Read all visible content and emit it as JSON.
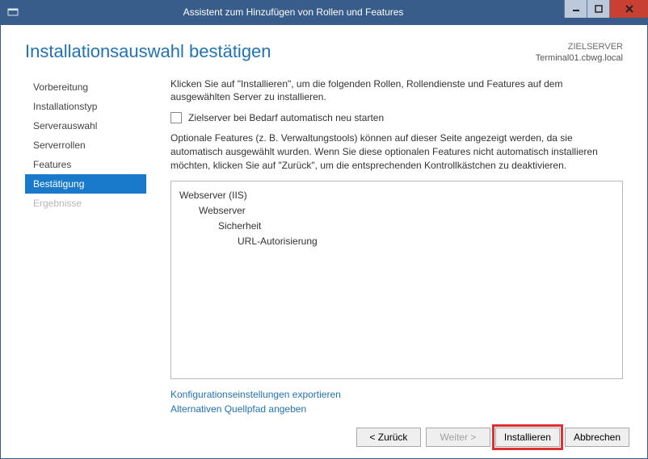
{
  "window": {
    "title": "Assistent zum Hinzufügen von Rollen und Features"
  },
  "header": {
    "heading": "Installationsauswahl bestätigen",
    "target_label": "ZIELSERVER",
    "target_value": "Terminal01.cbwg.local"
  },
  "nav": {
    "items": [
      {
        "label": "Vorbereitung"
      },
      {
        "label": "Installationstyp"
      },
      {
        "label": "Serverauswahl"
      },
      {
        "label": "Serverrollen"
      },
      {
        "label": "Features"
      },
      {
        "label": "Bestätigung"
      },
      {
        "label": "Ergebnisse"
      }
    ]
  },
  "content": {
    "description": "Klicken Sie auf \"Installieren\", um die folgenden Rollen, Rollendienste und Features auf dem ausgewählten Server zu installieren.",
    "restart_checkbox_label": "Zielserver bei Bedarf automatisch neu starten",
    "optional_text": "Optionale Features (z. B. Verwaltungstools) können auf dieser Seite angezeigt werden, da sie automatisch ausgewählt wurden. Wenn Sie diese optionalen Features nicht automatisch installieren möchten, klicken Sie auf \"Zurück\", um die entsprechenden Kontrollkästchen zu deaktivieren.",
    "tree": {
      "l0": "Webserver (IIS)",
      "l1": "Webserver",
      "l2": "Sicherheit",
      "l3": "URL-Autorisierung"
    },
    "link_export": "Konfigurationseinstellungen exportieren",
    "link_altpath": "Alternativen Quellpfad angeben"
  },
  "footer": {
    "back": "< Zurück",
    "next": "Weiter >",
    "install": "Installieren",
    "cancel": "Abbrechen"
  }
}
